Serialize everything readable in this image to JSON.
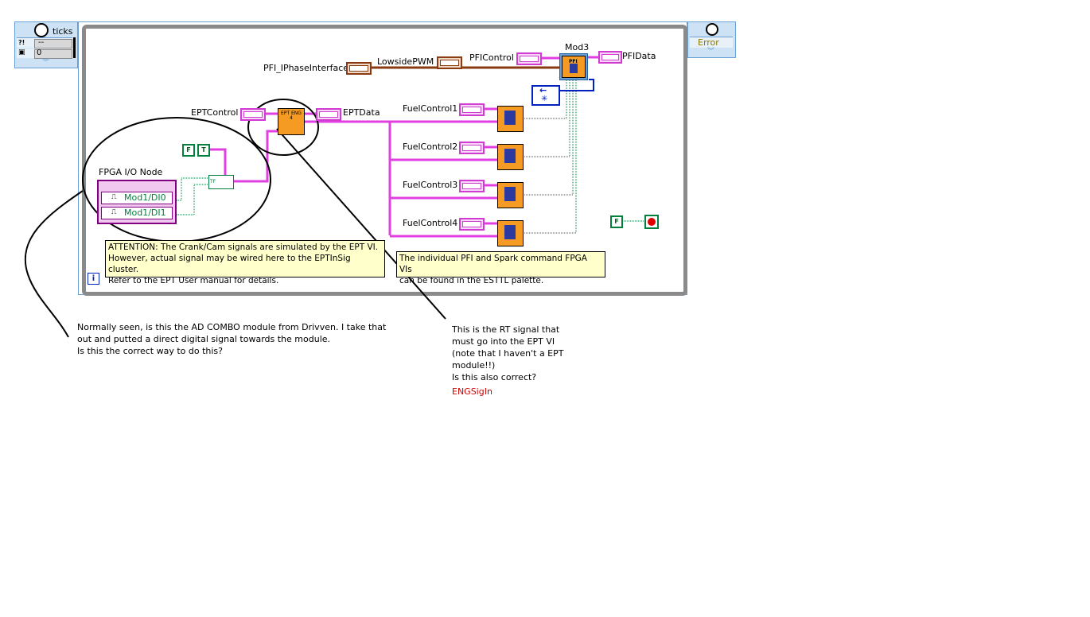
{
  "ticks_control": {
    "label": "ticks",
    "row1_value": "--",
    "row2_value": "0"
  },
  "error_control": {
    "label": "Error"
  },
  "diagram": {
    "pfi_iphase_label": "PFI_IPhaseInterface",
    "lowside_label": "LowsidePWM",
    "pficontrol_label": "PFIControl",
    "mod3_label": "Mod3",
    "pfidata_label": "PFIData",
    "pfi_vi_text": "PFI",
    "eptcontrol_label": "EPTControl",
    "eptdata_label": "EPTData",
    "ept_vi_text": "EPT ENG 4",
    "fuel_controls": [
      "FuelControl1",
      "FuelControl2",
      "FuelControl3",
      "FuelControl4"
    ],
    "fpga_node_label": "FPGA I/O Node",
    "fpga_items": [
      "Mod1/DI0",
      "Mod1/DI1"
    ],
    "bool_false": "F",
    "bool_true": "T",
    "stop_false": "F",
    "build_array_text": "TF",
    "note_attention": [
      "ATTENTION:  The Crank/Cam signals are simulated by the EPT VI.",
      "However, actual signal may be wired here to the EPTInSig cluster.",
      "Refer to the EPT User manual for details."
    ],
    "note_palette": [
      "The individual PFI and Spark command FPGA VIs",
      "can be found in the ESTTL palette."
    ],
    "info_icon": "i"
  },
  "comments": {
    "left": [
      "Normally seen, is this the AD COMBO module from Drivven. I take that",
      "out and putted a direct digital signal towards the module.",
      "Is this the correct way to do this?"
    ],
    "right": [
      "This is the RT signal that",
      "must go into the EPT VI",
      "(note that I haven't a EPT",
      "module!!)",
      "Is this also correct?"
    ],
    "right_red": "ENGSigIn"
  },
  "colors": {
    "cluster_wire": "#e040e0",
    "loop_border": "#808080",
    "vi_orange": "#f59a23",
    "bool_green": "#00803c",
    "comment_red": "#d00000"
  }
}
